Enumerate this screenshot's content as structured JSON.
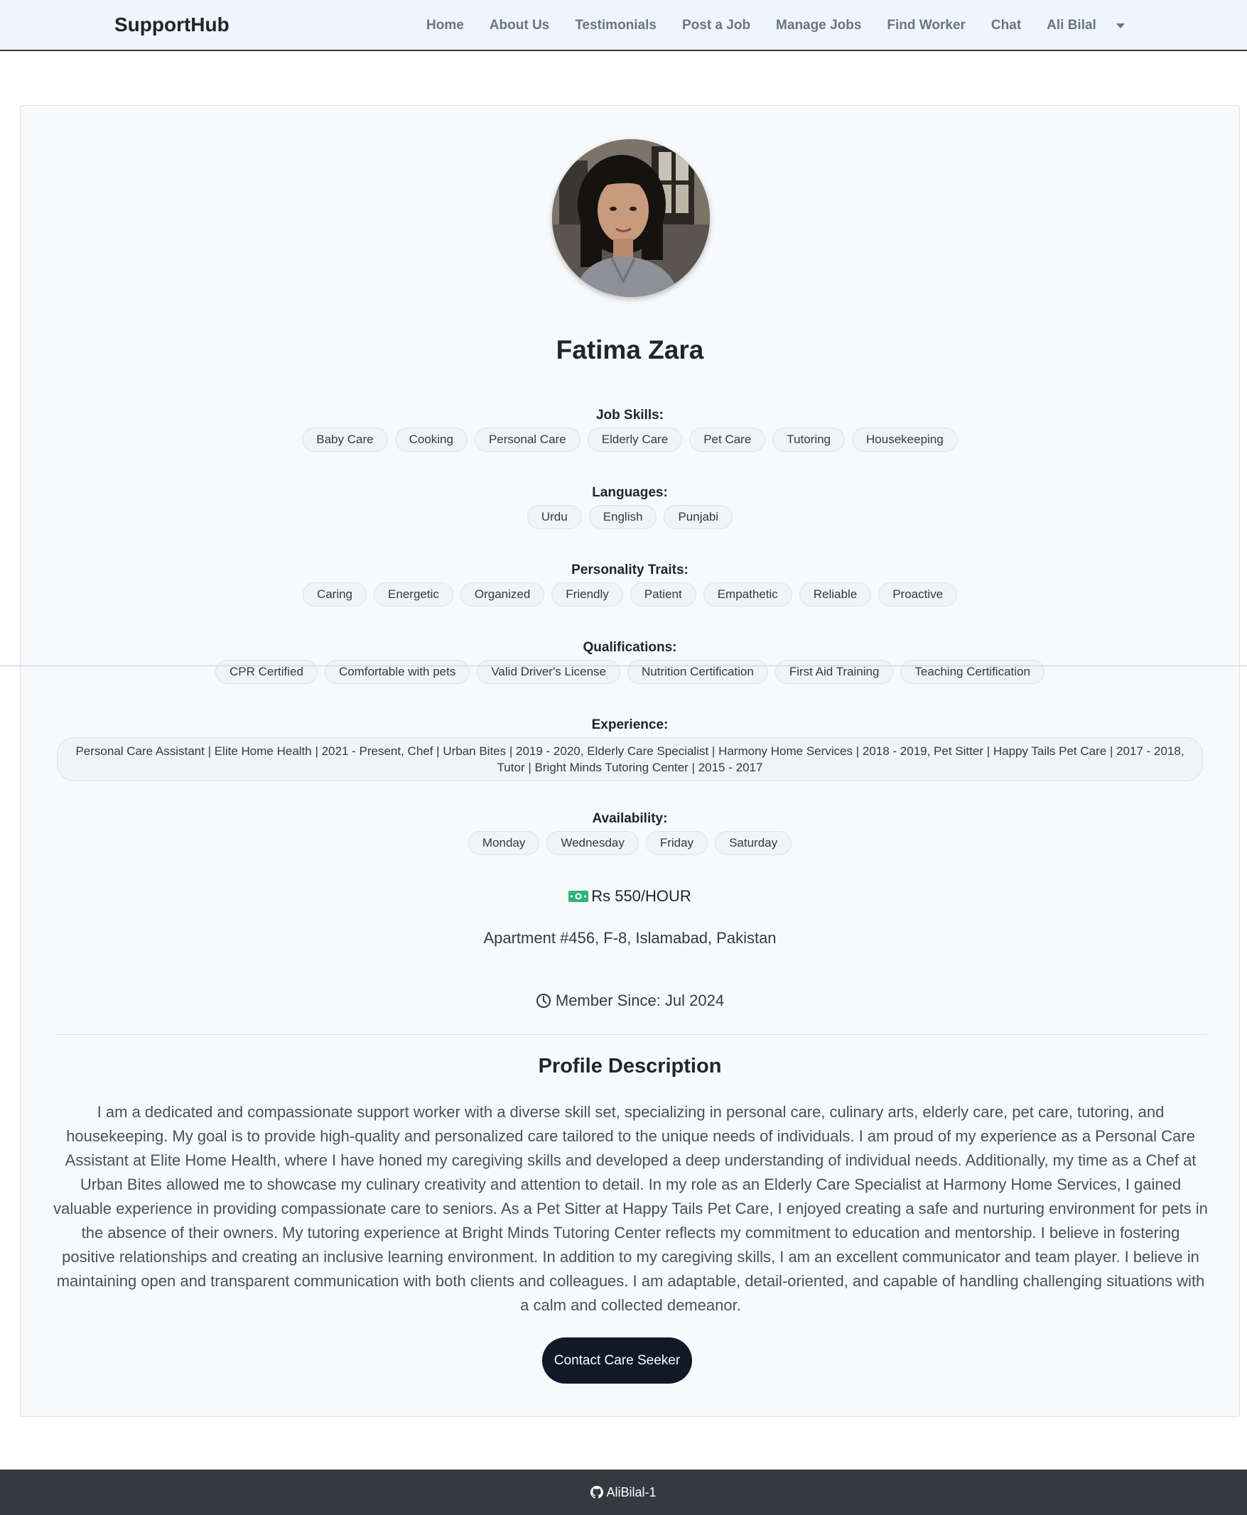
{
  "navbar": {
    "brand": "SupportHub",
    "links": [
      "Home",
      "About Us",
      "Testimonials",
      "Post a Job",
      "Manage Jobs",
      "Find Worker",
      "Chat"
    ],
    "user_name": "Ali Bilal"
  },
  "profile": {
    "name": "Fatima Zara",
    "job_skills_label": "Job Skills:",
    "job_skills": [
      "Baby Care",
      "Cooking",
      "Personal Care",
      "Elderly Care",
      "Pet Care",
      "Tutoring",
      "Housekeeping"
    ],
    "languages_label": "Languages:",
    "languages": [
      "Urdu",
      "English",
      "Punjabi"
    ],
    "traits_label": "Personality Traits:",
    "traits": [
      "Caring",
      "Energetic",
      "Organized",
      "Friendly",
      "Patient",
      "Empathetic",
      "Reliable",
      "Proactive"
    ],
    "qualifications_label": "Qualifications:",
    "qualifications": [
      "CPR Certified",
      "Comfortable with pets",
      "Valid Driver's License",
      "Nutrition Certification",
      "First Aid Training",
      "Teaching Certification"
    ],
    "experience_label": "Experience:",
    "experience": "Personal Care Assistant | Elite Home Health | 2021 - Present, Chef | Urban Bites | 2019 - 2020, Elderly Care Specialist | Harmony Home Services | 2018 - 2019, Pet Sitter | Happy Tails Pet Care | 2017 - 2018, Tutor | Bright Minds Tutoring Center | 2015 - 2017",
    "availability_label": "Availability:",
    "availability": [
      "Monday",
      "Wednesday",
      "Friday",
      "Saturday"
    ],
    "rate": "Rs 550/HOUR",
    "address": "Apartment #456, F-8, Islamabad, Pakistan",
    "member_since": "Member Since: Jul 2024",
    "description_title": "Profile Description",
    "description": "I am a dedicated and compassionate support worker with a diverse skill set, specializing in personal care, culinary arts, elderly care, pet care, tutoring, and housekeeping. My goal is to provide high-quality and personalized care tailored to the unique needs of individuals. I am proud of my experience as a Personal Care Assistant at Elite Home Health, where I have honed my caregiving skills and developed a deep understanding of individual needs. Additionally, my time as a Chef at Urban Bites allowed me to showcase my culinary creativity and attention to detail. In my role as an Elderly Care Specialist at Harmony Home Services, I gained valuable experience in providing compassionate care to seniors. As a Pet Sitter at Happy Tails Pet Care, I enjoyed creating a safe and nurturing environment for pets in the absence of their owners. My tutoring experience at Bright Minds Tutoring Center reflects my commitment to education and mentorship. I believe in fostering positive relationships and creating an inclusive learning environment. In addition to my caregiving skills, I am an excellent communicator and team player. I believe in maintaining open and transparent communication with both clients and colleagues. I am adaptable, detail-oriented, and capable of handling challenging situations with a calm and collected demeanor.",
    "contact_button": "Contact Care Seeker"
  },
  "footer": {
    "github_user": "AliBilal-1"
  },
  "icons": {
    "money": "money-bill-icon",
    "clock": "clock-icon",
    "github": "github-icon",
    "caret": "caret-down-icon"
  },
  "colors": {
    "navbar_bg": "#eef5fc",
    "button_bg": "#111827",
    "footer_bg": "#343a40",
    "money_green": "#2fb37a"
  }
}
